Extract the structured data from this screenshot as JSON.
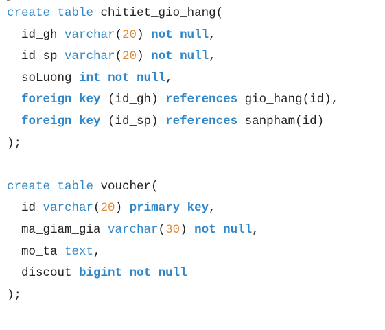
{
  "editor": {
    "colors": {
      "keyword": "#3288c6",
      "number": "#de8a3c",
      "text": "#222222",
      "background": "#ffffff"
    },
    "lines": [
      [
        [
          "k",
          "create"
        ],
        [
          "p",
          " "
        ],
        [
          "k",
          "table"
        ],
        [
          "t",
          " chitiet_gio_hang("
        ]
      ],
      [
        [
          "t",
          "  id_gh "
        ],
        [
          "k",
          "varchar"
        ],
        [
          "p",
          "("
        ],
        [
          "n",
          "20"
        ],
        [
          "p",
          ") "
        ],
        [
          "kb",
          "not null"
        ],
        [
          "p",
          ","
        ]
      ],
      [
        [
          "t",
          "  id_sp "
        ],
        [
          "k",
          "varchar"
        ],
        [
          "p",
          "("
        ],
        [
          "n",
          "20"
        ],
        [
          "p",
          ") "
        ],
        [
          "kb",
          "not null"
        ],
        [
          "p",
          ","
        ]
      ],
      [
        [
          "t",
          "  soLuong "
        ],
        [
          "kb",
          "int"
        ],
        [
          "p",
          " "
        ],
        [
          "kb",
          "not null"
        ],
        [
          "p",
          ","
        ]
      ],
      [
        [
          "p",
          "  "
        ],
        [
          "kb",
          "foreign key"
        ],
        [
          "t",
          " (id_gh) "
        ],
        [
          "kb",
          "references"
        ],
        [
          "t",
          " gio_hang(id),"
        ]
      ],
      [
        [
          "p",
          "  "
        ],
        [
          "kb",
          "foreign key"
        ],
        [
          "t",
          " (id_sp) "
        ],
        [
          "kb",
          "references"
        ],
        [
          "t",
          " sanpham(id)"
        ]
      ],
      [
        [
          "p",
          ");"
        ]
      ],
      [],
      [
        [
          "k",
          "create"
        ],
        [
          "p",
          " "
        ],
        [
          "k",
          "table"
        ],
        [
          "t",
          " voucher("
        ]
      ],
      [
        [
          "t",
          "  id "
        ],
        [
          "k",
          "varchar"
        ],
        [
          "p",
          "("
        ],
        [
          "n",
          "20"
        ],
        [
          "p",
          ") "
        ],
        [
          "kb",
          "primary key"
        ],
        [
          "p",
          ","
        ]
      ],
      [
        [
          "t",
          "  ma_giam_gia "
        ],
        [
          "k",
          "varchar"
        ],
        [
          "p",
          "("
        ],
        [
          "n",
          "30"
        ],
        [
          "p",
          ") "
        ],
        [
          "kb",
          "not null"
        ],
        [
          "p",
          ","
        ]
      ],
      [
        [
          "t",
          "  mo_ta "
        ],
        [
          "k",
          "text"
        ],
        [
          "p",
          ","
        ]
      ],
      [
        [
          "t",
          "  discout "
        ],
        [
          "kb",
          "bigint"
        ],
        [
          "p",
          " "
        ],
        [
          "kb",
          "not null"
        ]
      ],
      [
        [
          "p",
          ");"
        ]
      ]
    ]
  }
}
